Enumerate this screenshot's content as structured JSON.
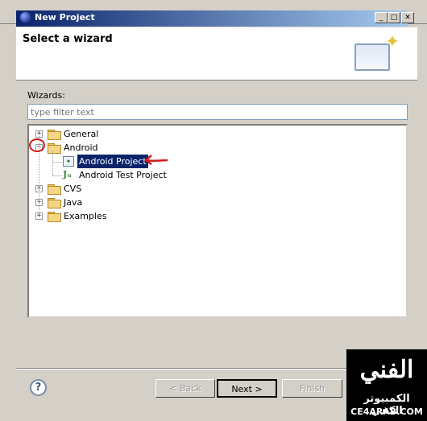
{
  "window": {
    "title": "New Project",
    "min_glyph": "_",
    "max_glyph": "□",
    "close_glyph": "✕"
  },
  "header": {
    "title": "Select a wizard"
  },
  "wizards_label": "Wizards:",
  "filter": {
    "placeholder": "type filter text",
    "value": ""
  },
  "tree": {
    "items": [
      {
        "label": "General",
        "toggle": "+",
        "icon": "folder-icon"
      },
      {
        "label": "Android",
        "toggle": "−",
        "icon": "folder-open-icon",
        "children": [
          {
            "label": "Android Project",
            "icon": "android-project-icon",
            "selected": true
          },
          {
            "label": "Android Test Project",
            "icon": "junit-icon"
          }
        ]
      },
      {
        "label": "CVS",
        "toggle": "+",
        "icon": "folder-icon"
      },
      {
        "label": "Java",
        "toggle": "+",
        "icon": "folder-icon"
      },
      {
        "label": "Examples",
        "toggle": "+",
        "icon": "folder-icon"
      }
    ]
  },
  "buttons": {
    "help": "?",
    "back": "< Back",
    "next": "Next >",
    "finish": "Finish"
  },
  "watermark": {
    "logo": "الفني",
    "arabic": "الكمبيوتر الكفي",
    "domain": "CE4ARAB.COM"
  },
  "colors": {
    "title_bar_start": "#0a246a",
    "title_bar_end": "#a6caf0",
    "selection": "#0a246a",
    "annotation": "#d21a1a"
  }
}
